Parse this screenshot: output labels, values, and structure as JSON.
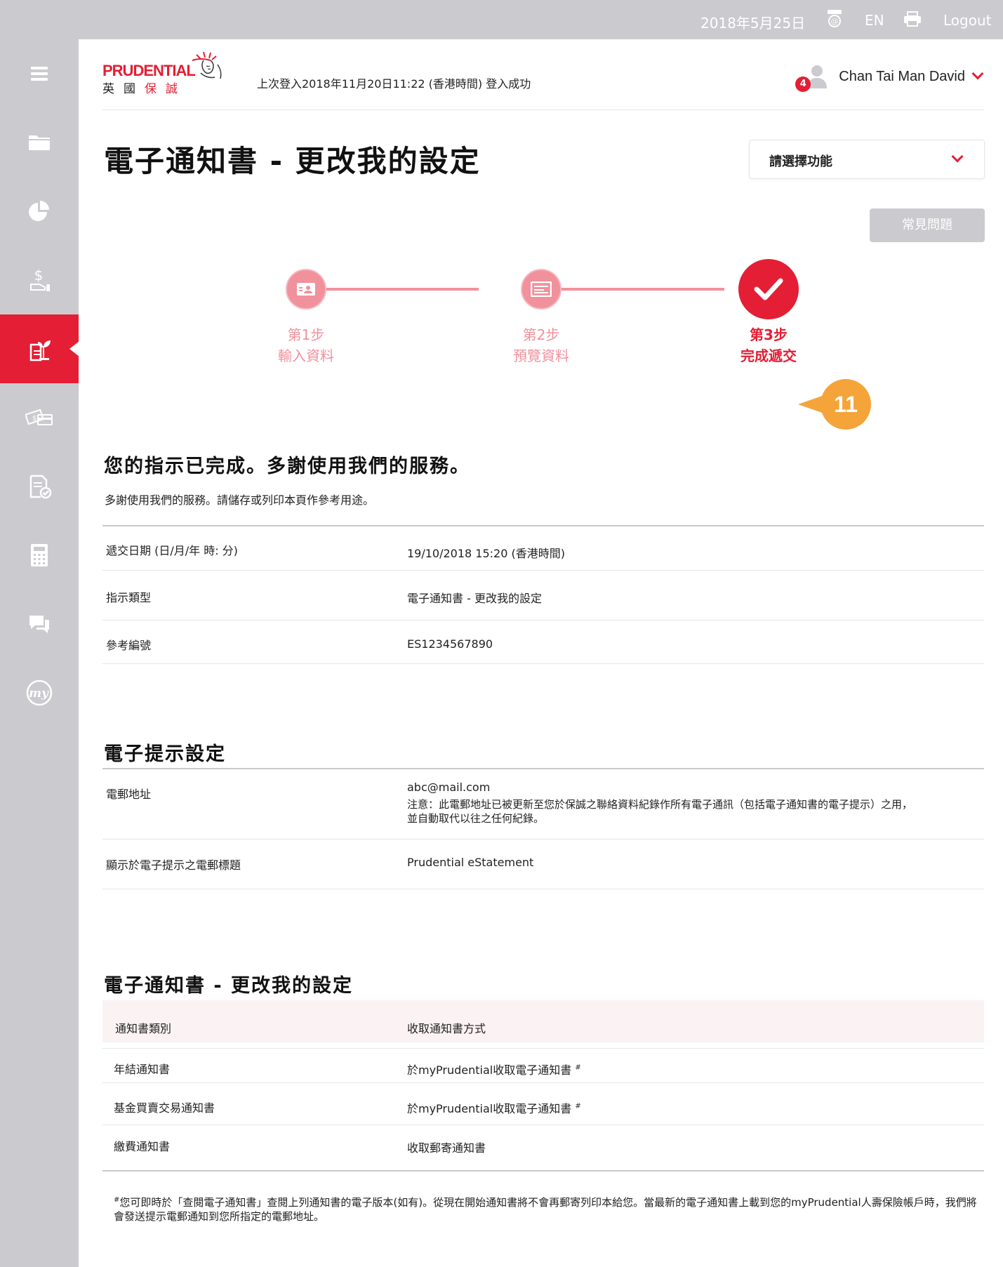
{
  "topbar": {
    "date": "2018年5月25日",
    "language": "EN",
    "logout": "Logout"
  },
  "sidebar": {
    "items": [
      {
        "icon": "menu-icon",
        "active": false
      },
      {
        "icon": "folder-icon",
        "active": false
      },
      {
        "icon": "pie-chart-icon",
        "active": false
      },
      {
        "icon": "dollar-hand-icon",
        "active": false
      },
      {
        "icon": "estatement-plant-icon",
        "active": true
      },
      {
        "icon": "cash-card-icon",
        "active": false
      },
      {
        "icon": "document-check-icon",
        "active": false
      },
      {
        "icon": "calculator-icon",
        "active": false
      },
      {
        "icon": "chat-icon",
        "active": false
      },
      {
        "icon": "my-logo-icon",
        "active": false
      }
    ]
  },
  "header": {
    "logo_en": "PRUDENTIAL",
    "logo_zh": [
      "英",
      "國",
      "保",
      "誠"
    ],
    "last_login": "上次登入2018年11月20日11:22 (香港時間) 登入成功",
    "user_name": "Chan Tai Man David",
    "notification_count": "4"
  },
  "page": {
    "title": "電子通知書 - 更改我的設定",
    "function_select": "請選擇功能",
    "faq_button": "常見問題"
  },
  "stepper": {
    "steps": [
      {
        "line1": "第1步",
        "line2": "輸入資料",
        "status": "done"
      },
      {
        "line1": "第2步",
        "line2": "預覽資料",
        "status": "done"
      },
      {
        "line1": "第3步",
        "line2": "完成遞交",
        "status": "current"
      }
    ],
    "annotation": "11"
  },
  "completion": {
    "heading": "您的指示已完成。多謝使用我們的服務。",
    "subtext": "多謝使用我們的服務。請儲存或列印本頁作參考用途。",
    "rows": [
      {
        "label": "遞交日期 (日/月/年 時: 分)",
        "value": "19/10/2018 15:20 (香港時間)"
      },
      {
        "label": "指示類型",
        "value": "電子通知書 - 更改我的設定"
      },
      {
        "label": "參考編號",
        "value": "ES1234567890"
      }
    ]
  },
  "alert_settings": {
    "heading": "電子提示設定",
    "email_label": "電郵地址",
    "email_value": "abc@mail.com",
    "email_note_1": "注意：此電郵地址已被更新至您於保誠之聯絡資料紀錄作所有電子通訊（包括電子通知書的電子提示）之用，",
    "email_note_2": "並自動取代以往之任何紀錄。",
    "subject_label": "顯示於電子提示之電郵標題",
    "subject_value": "Prudential eStatement"
  },
  "preferences": {
    "heading": "電子通知書 - 更改我的設定",
    "col_type": "通知書類別",
    "col_method": "收取通知書方式",
    "rows": [
      {
        "type": "年結通知書",
        "method": "於myPrudential收取電子通知書",
        "mark": "#"
      },
      {
        "type": "基金買賣交易通知書",
        "method": "於myPrudential收取電子通知書",
        "mark": "#"
      },
      {
        "type": "繳費通知書",
        "method": "收取郵寄通知書",
        "mark": ""
      }
    ],
    "footnote_mark": "#",
    "footnote": "您可即時於「查閱電子通知書」查閱上列通知書的電子版本(如有)。從現在開始通知書將不會再郵寄列印本給您。當最新的電子通知書上載到您的myPrudential人壽保險帳戶時，我們將會發送提示電郵通知到您所指定的電郵地址。"
  },
  "colors": {
    "brand_red": "#e41e34",
    "step_pink": "#f0919c",
    "annotation_orange": "#f5a43a",
    "chrome_grey": "#cbcbcf"
  }
}
